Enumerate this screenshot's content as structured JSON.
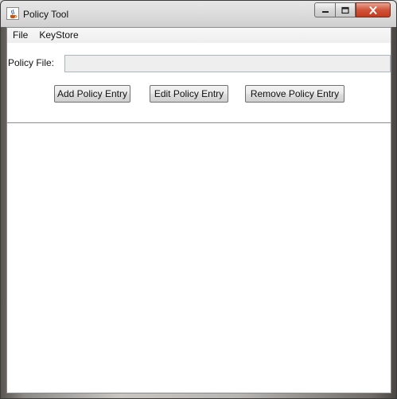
{
  "window": {
    "title": "Policy Tool",
    "app_icon": "java-cup-icon",
    "controls": {
      "minimize_icon": "minimize-icon",
      "maximize_icon": "maximize-icon",
      "close_icon": "close-icon"
    },
    "close_color": "#c9432a"
  },
  "menubar": {
    "items": [
      {
        "label": "File"
      },
      {
        "label": "KeyStore"
      }
    ]
  },
  "policy_file": {
    "label": "Policy File:",
    "value": ""
  },
  "buttons": {
    "add": "Add Policy Entry",
    "edit": "Edit Policy Entry",
    "remove": "Remove Policy Entry"
  },
  "policy_entries": []
}
